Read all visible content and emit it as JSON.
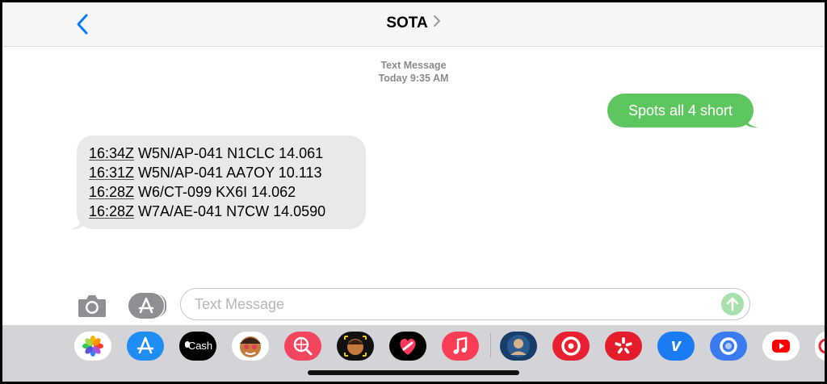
{
  "header": {
    "title": "SOTA"
  },
  "thread": {
    "meta_type": "Text Message",
    "meta_time": "Today 9:35 AM",
    "outgoing": {
      "text": "Spots all 4 short"
    },
    "incoming": {
      "lines": [
        {
          "time": "16:34Z",
          "text": " W5N/AP-041 N1CLC 14.061"
        },
        {
          "time": "16:31Z",
          "text": " W5N/AP-041 AA7OY 10.113"
        },
        {
          "time": "16:28Z",
          "text": " W6/CT-099 KX6I 14.062"
        },
        {
          "time": "16:28Z",
          "text": " W7A/AE-041 N7CW 14.0590"
        }
      ]
    },
    "colors": {
      "outgoing_bubble": "#5dc65f",
      "incoming_bubble": "#e9e9eb",
      "accent": "#0a7aff"
    }
  },
  "composer": {
    "placeholder": "Text Message"
  },
  "app_drawer": {
    "apps": [
      {
        "name": "photos-app-icon"
      },
      {
        "name": "app-store-icon"
      },
      {
        "name": "apple-cash-icon",
        "label": "Cash"
      },
      {
        "name": "memoji-stickers-icon"
      },
      {
        "name": "images-search-icon"
      },
      {
        "name": "memoji-icon"
      },
      {
        "name": "digital-touch-icon"
      },
      {
        "name": "music-icon"
      },
      {
        "name": "sticker-app-icon"
      },
      {
        "name": "target-app-icon"
      },
      {
        "name": "yelp-app-icon"
      },
      {
        "name": "venmo-app-icon",
        "label": "v"
      },
      {
        "name": "circle-app-icon"
      },
      {
        "name": "youtube-app-icon"
      }
    ]
  }
}
